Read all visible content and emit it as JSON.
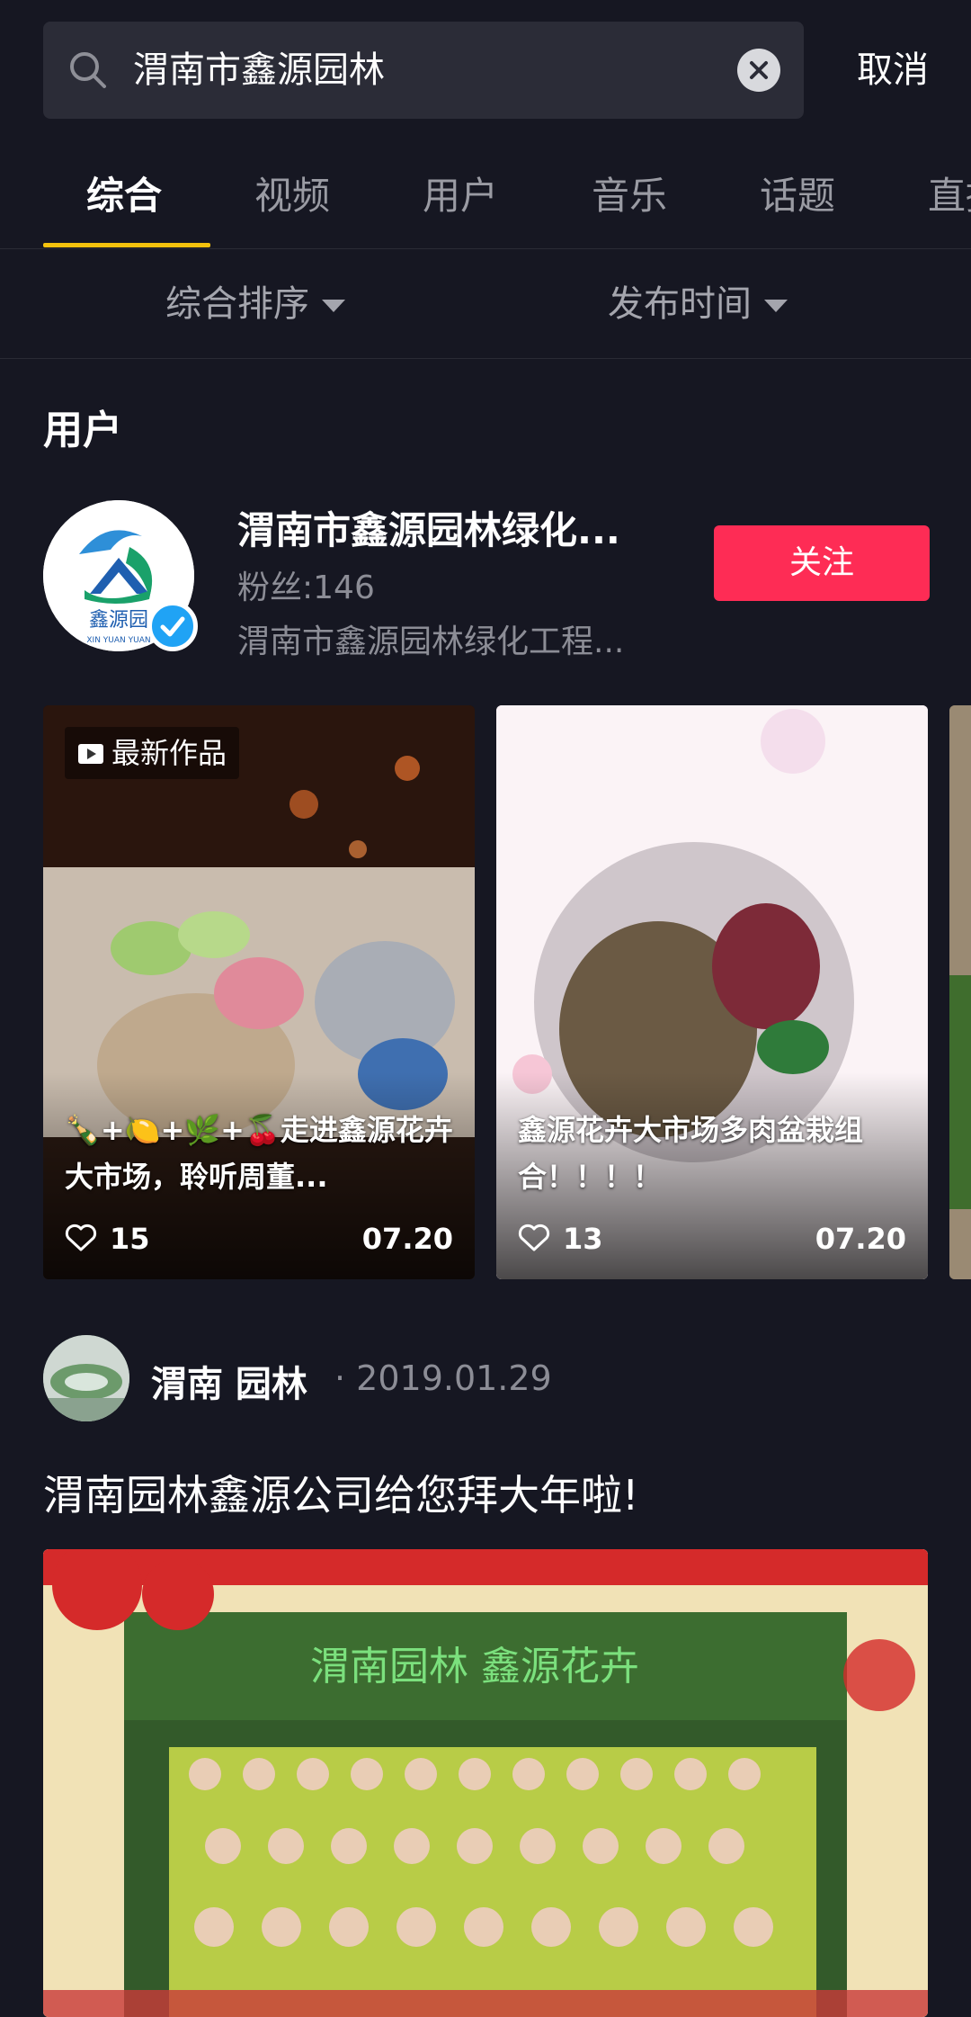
{
  "search": {
    "query": "渭南市鑫源园林",
    "cancel_label": "取消"
  },
  "tabs": [
    {
      "label": "综合",
      "active": true
    },
    {
      "label": "视频"
    },
    {
      "label": "用户"
    },
    {
      "label": "音乐"
    },
    {
      "label": "话题"
    },
    {
      "label": "直播"
    }
  ],
  "filters": [
    {
      "label": "综合排序"
    },
    {
      "label": "发布时间"
    }
  ],
  "users_section": {
    "title": "用户",
    "user": {
      "name": "渭南市鑫源园林绿化...",
      "fans": "粉丝:146",
      "description": "渭南市鑫源园林绿化工程...",
      "follow_label": "关注",
      "logo_text": "鑫源园",
      "logo_subtext": "XIN YUAN YUAN"
    },
    "videos": [
      {
        "badge": "最新作品",
        "title": "🍾+🍋+🌿+🍒走进鑫源花卉大市场，聆听周董...",
        "likes": "15",
        "date": "07.20"
      },
      {
        "title": "鑫源花卉大市场多肉盆栽组合！！！！",
        "likes": "13",
        "date": "07.20"
      }
    ]
  },
  "post": {
    "author": "渭南 园林",
    "date": "· 2019.01.29",
    "text": "渭南园林鑫源公司给您拜大年啦!",
    "image_caption": "渭南园林    鑫源花卉"
  },
  "colors": {
    "background": "#161722",
    "accent_yellow": "#f4c20d",
    "follow_red": "#fe2c55",
    "verified_blue": "#20a3f5"
  },
  "icons": {
    "search": "search-icon",
    "clear": "clear-icon",
    "verified": "verified-icon",
    "heart": "heart-icon",
    "play": "play-icon"
  }
}
